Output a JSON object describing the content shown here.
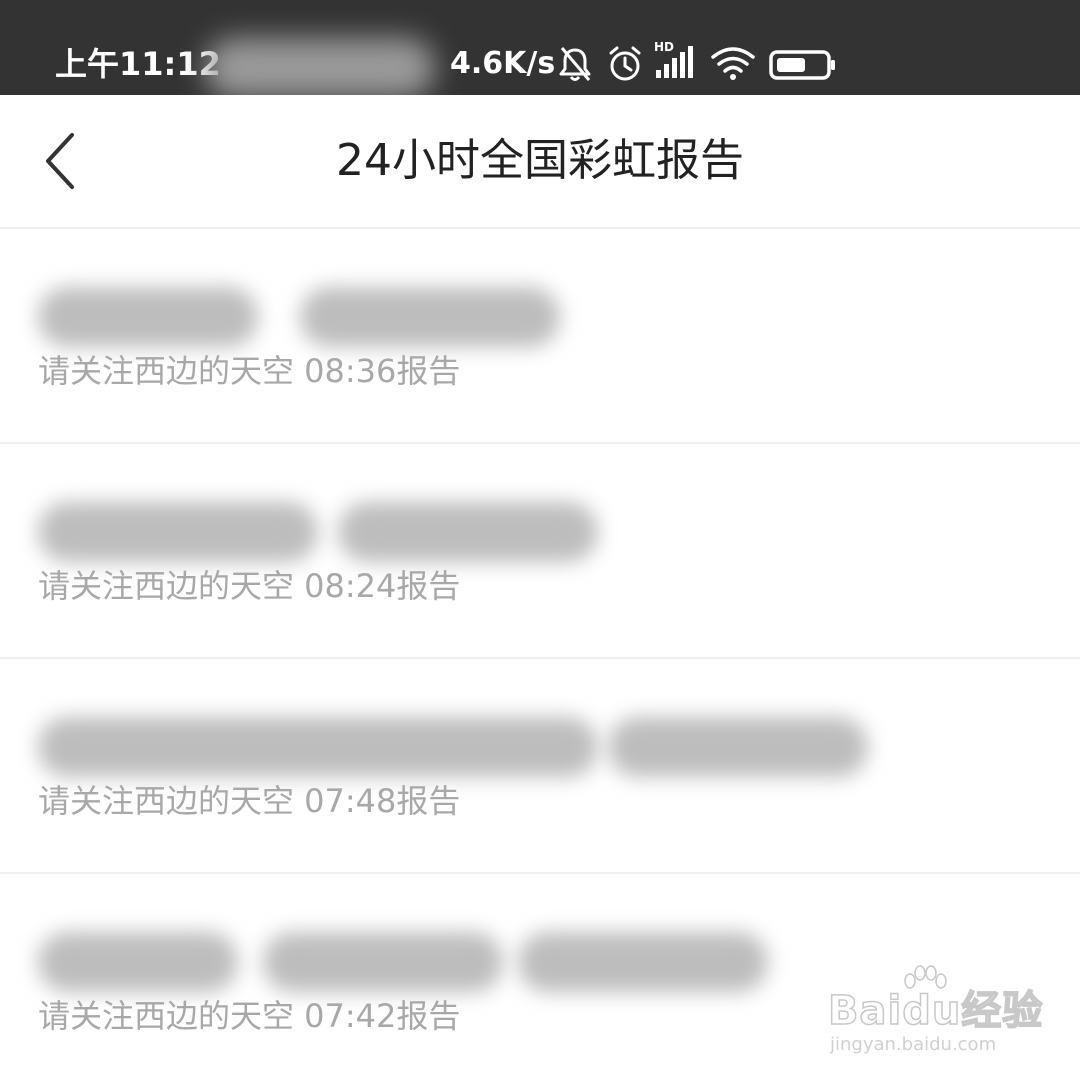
{
  "status_bar": {
    "time": "上午11:12",
    "network_speed": "4.6K/s",
    "hd_label": "HD",
    "icons": [
      "bell-muted-icon",
      "alarm-icon",
      "cell-signal-icon",
      "wifi-icon",
      "battery-icon"
    ],
    "battery_level": 0.6
  },
  "header": {
    "back_icon": "chevron-left-icon",
    "title": "24小时全国彩虹报告"
  },
  "reports": [
    {
      "subtitle": "请关注西边的天空 08:36报告"
    },
    {
      "subtitle": "请关注西边的天空 08:24报告"
    },
    {
      "subtitle": "请关注西边的天空 07:48报告"
    },
    {
      "subtitle": "请关注西边的天空 07:42报告"
    }
  ],
  "watermark": {
    "brand": "Baidu经验",
    "url": "jingyan.baidu.com"
  },
  "colors": {
    "status_bar_bg": "#333333",
    "title_text": "#222222",
    "subtitle_text": "#a8a8a8",
    "divider": "#f0f0f0"
  }
}
